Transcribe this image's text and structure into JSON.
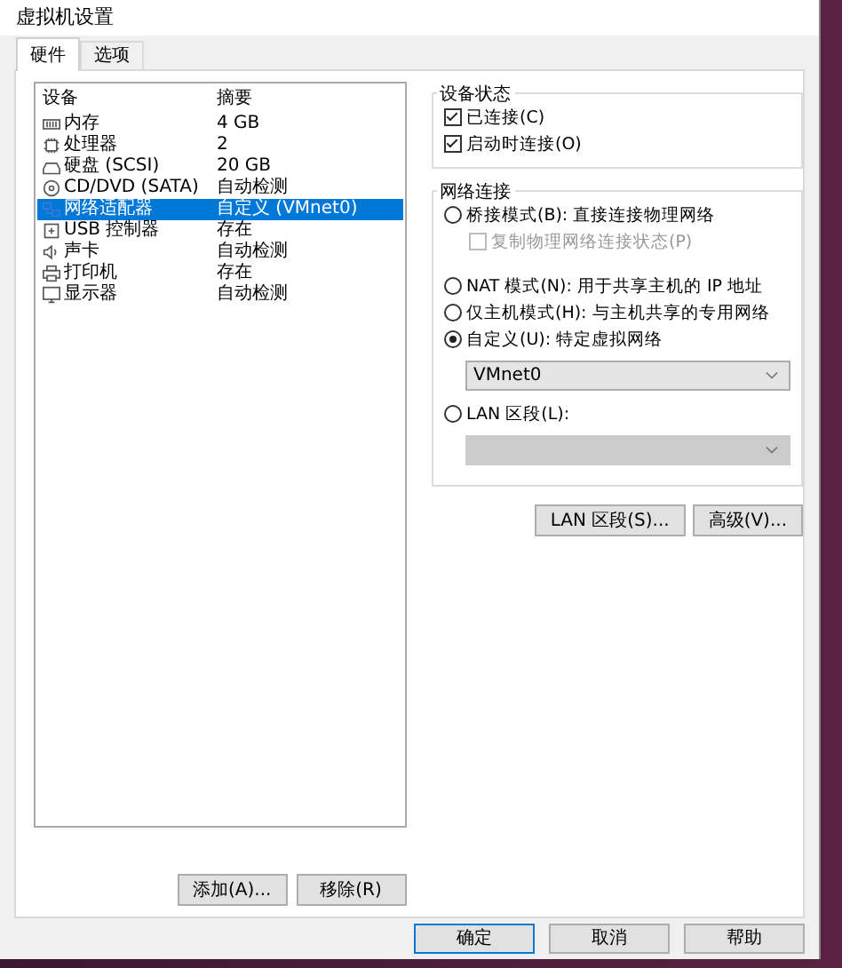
{
  "window": {
    "title": "虚拟机设置"
  },
  "tabs": [
    {
      "label": "硬件",
      "selected": true
    },
    {
      "label": "选项",
      "selected": false
    }
  ],
  "device_list": {
    "columns": [
      "设备",
      "摘要"
    ],
    "rows": [
      {
        "kind": "memory",
        "device": "内存",
        "summary": "4 GB",
        "selected": false
      },
      {
        "kind": "cpu",
        "device": "处理器",
        "summary": "2",
        "selected": false
      },
      {
        "kind": "disk",
        "device": "硬盘 (SCSI)",
        "summary": "20 GB",
        "selected": false
      },
      {
        "kind": "cdrom",
        "device": "CD/DVD (SATA)",
        "summary": "自动检测",
        "selected": false
      },
      {
        "kind": "network",
        "device": "网络适配器",
        "summary": "自定义 (VMnet0)",
        "selected": true
      },
      {
        "kind": "usb",
        "device": "USB 控制器",
        "summary": "存在",
        "selected": false
      },
      {
        "kind": "sound",
        "device": "声卡",
        "summary": "自动检测",
        "selected": false
      },
      {
        "kind": "printer",
        "device": "打印机",
        "summary": "存在",
        "selected": false
      },
      {
        "kind": "display",
        "device": "显示器",
        "summary": "自动检测",
        "selected": false
      }
    ]
  },
  "list_buttons": [
    "添加(A)...",
    "移除(R)"
  ],
  "device_status": {
    "title": "设备状态",
    "options": [
      {
        "label": "已连接(C)",
        "checked": true
      },
      {
        "label": "启动时连接(O)",
        "checked": true
      }
    ]
  },
  "network_connection": {
    "title": "网络连接",
    "options": [
      {
        "kind": "radio",
        "label": "桥接模式(B): 直接连接物理网络",
        "selected": false
      },
      {
        "kind": "checkbox",
        "label": "复制物理网络连接状态(P)",
        "checked": false,
        "disabled": true
      },
      {
        "kind": "radio",
        "label": "NAT 模式(N): 用于共享主机的 IP 地址",
        "selected": false
      },
      {
        "kind": "radio",
        "label": "仅主机模式(H): 与主机共享的专用网络",
        "selected": false
      },
      {
        "kind": "radio",
        "label": "自定义(U): 特定虚拟网络",
        "selected": true
      },
      {
        "kind": "dropdown",
        "value": "VMnet0",
        "disabled": false
      },
      {
        "kind": "radio",
        "label": "LAN 区段(L):",
        "selected": false
      },
      {
        "kind": "dropdown",
        "disabled": true
      }
    ]
  },
  "network_buttons": [
    "LAN 区段(S)...",
    "高级(V)..."
  ],
  "dialog_buttons": [
    {
      "label": "确定",
      "default": true
    },
    {
      "label": "取消",
      "default": false
    },
    {
      "label": "帮助",
      "default": false
    }
  ]
}
